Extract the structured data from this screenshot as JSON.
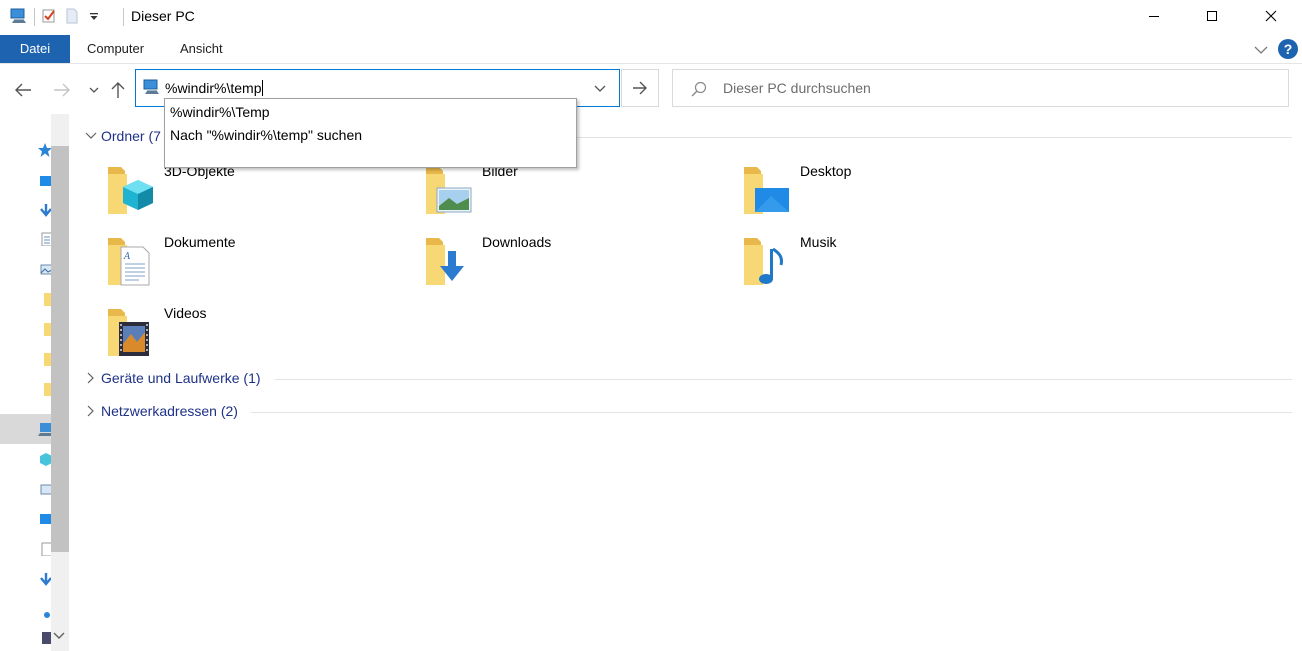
{
  "window": {
    "title": "Dieser PC",
    "controls": {
      "minimize": "minimize",
      "maximize": "maximize",
      "close": "close"
    }
  },
  "ribbon": {
    "tabs": [
      {
        "label": "Datei",
        "active": true
      },
      {
        "label": "Computer"
      },
      {
        "label": "Ansicht"
      }
    ],
    "help_label": "?"
  },
  "address_bar": {
    "value": "%windir%\\temp",
    "suggestions": [
      "%windir%\\Temp",
      "Nach \"%windir%\\temp\" suchen"
    ]
  },
  "search": {
    "placeholder": "Dieser PC durchsuchen"
  },
  "groups": {
    "folders": {
      "title": "Ordner (7",
      "expanded": true,
      "items": [
        {
          "label": "3D-Objekte",
          "icon": "3d-objects-folder-icon"
        },
        {
          "label": "Bilder",
          "icon": "pictures-folder-icon"
        },
        {
          "label": "Desktop",
          "icon": "desktop-folder-icon"
        },
        {
          "label": "Dokumente",
          "icon": "documents-folder-icon"
        },
        {
          "label": "Downloads",
          "icon": "downloads-folder-icon"
        },
        {
          "label": "Musik",
          "icon": "music-folder-icon"
        },
        {
          "label": "Videos",
          "icon": "videos-folder-icon"
        }
      ]
    },
    "devices": {
      "title": "Geräte und Laufwerke (1)",
      "expanded": false
    },
    "network": {
      "title": "Netzwerkadressen (2)",
      "expanded": false
    }
  },
  "colors": {
    "accent": "#1e63b0",
    "group_title": "#1e3287",
    "folder_yellow": "#f8d775",
    "selection": "#d9d9d9"
  }
}
